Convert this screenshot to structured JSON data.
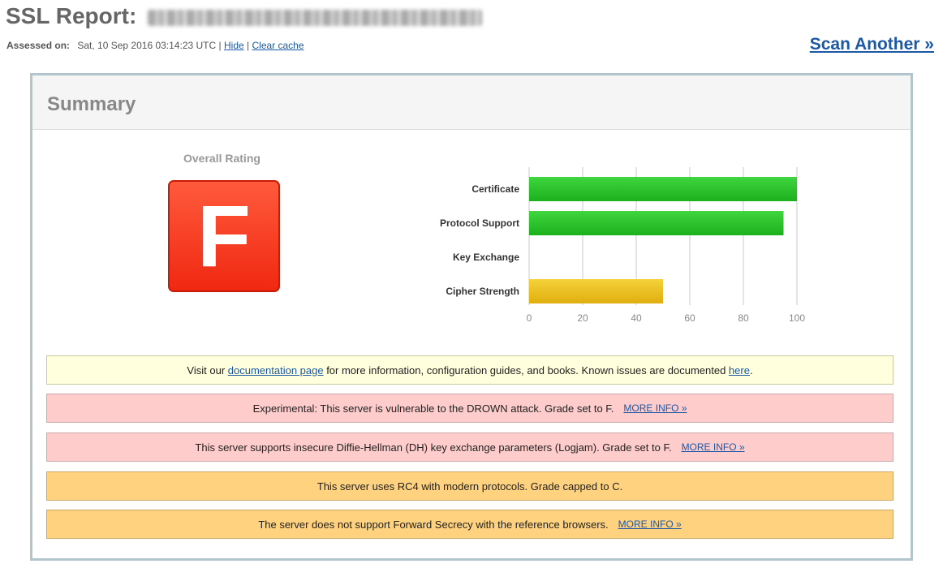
{
  "header": {
    "title_prefix": "SSL Report:",
    "assessed_label": "Assessed on:",
    "assessed_value": "Sat, 10 Sep 2016 03:14:23 UTC",
    "separator": "|",
    "hide_link": "Hide",
    "clear_cache_link": "Clear cache",
    "scan_another": "Scan Another »"
  },
  "summary": {
    "heading": "Summary",
    "overall_rating_label": "Overall Rating",
    "grade": "F",
    "grade_color": "#f24a30"
  },
  "chart_data": {
    "type": "bar",
    "orientation": "horizontal",
    "categories": [
      "Certificate",
      "Protocol Support",
      "Key Exchange",
      "Cipher Strength"
    ],
    "values": [
      100,
      95,
      0,
      50
    ],
    "colors": [
      "#27c427",
      "#27c427",
      "#27c427",
      "#e9bf1c"
    ],
    "xlim": [
      0,
      100
    ],
    "ticks": [
      0,
      20,
      40,
      60,
      80,
      100
    ],
    "grid": true
  },
  "notices": [
    {
      "style": "yellow",
      "pre": "Visit our ",
      "link1": "documentation page",
      "mid": " for more information, configuration guides, and books. Known issues are documented ",
      "link2": "here",
      "post": "."
    },
    {
      "style": "red",
      "text": "Experimental: This server is vulnerable to the DROWN attack. Grade set to F.",
      "more": "MORE INFO »"
    },
    {
      "style": "red",
      "text": "This server supports insecure Diffie-Hellman (DH) key exchange parameters (Logjam). Grade set to F.",
      "more": "MORE INFO »"
    },
    {
      "style": "orange",
      "text": "This server uses RC4 with modern protocols. Grade capped to C."
    },
    {
      "style": "orange",
      "text": "The server does not support Forward Secrecy with the reference browsers.",
      "more": "MORE INFO »"
    }
  ]
}
